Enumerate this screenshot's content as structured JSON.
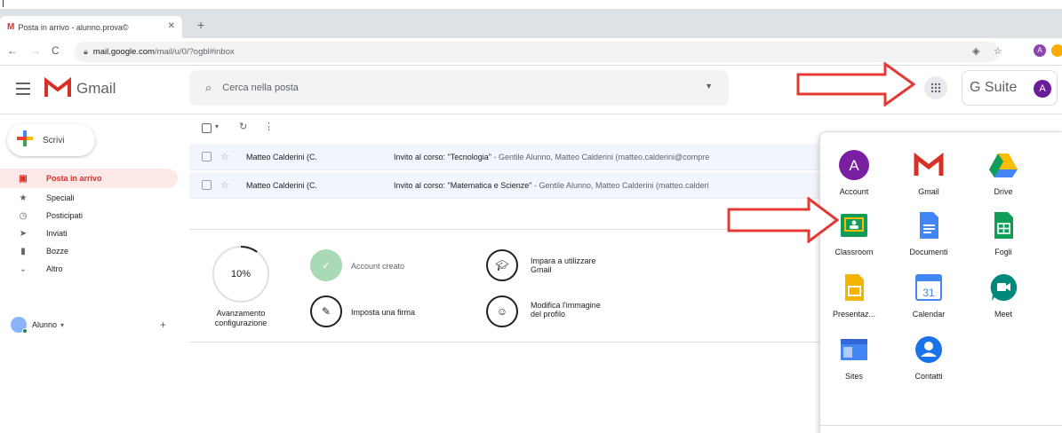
{
  "browser": {
    "tab_title": "Posta in arrivo - alunno.prova©",
    "url_host": "mail.google.com",
    "url_path": "/mail/u/0/?ogbl#inbox",
    "profile_initial": "A"
  },
  "header": {
    "app_name": "Gmail",
    "search_placeholder": "Cerca nella posta",
    "gsuite_label": "G Suite",
    "avatar_initial": "A"
  },
  "sidebar": {
    "compose_label": "Scrivi",
    "items": [
      {
        "label": "Posta in arrivo",
        "icon": "inbox-icon",
        "active": true
      },
      {
        "label": "Speciali",
        "icon": "star-icon"
      },
      {
        "label": "Posticipati",
        "icon": "clock-icon"
      },
      {
        "label": "Inviati",
        "icon": "send-icon"
      },
      {
        "label": "Bozze",
        "icon": "draft-icon"
      },
      {
        "label": "Altro",
        "icon": "chevron-down-icon"
      }
    ],
    "user_label": "Alunno"
  },
  "emails": [
    {
      "sender": "Matteo Calderini (C.",
      "subject": "Invito al corso: \"Tecnologia\"",
      "snippet": " - Gentile Alunno, Matteo Calderini (matteo.calderini@compre"
    },
    {
      "sender": "Matteo Calderini (C.",
      "subject": "Invito al corso: \"Matematica e Scienze\"",
      "snippet": " - Gentile Alunno, Matteo Calderini (matteo.calderi"
    }
  ],
  "setup": {
    "progress_text": "10%",
    "progress_value": 0.1,
    "progress_label_1": "Avanzamento",
    "progress_label_2": "configurazione",
    "steps": [
      {
        "label": "Account creato",
        "done": true
      },
      {
        "label": "Impara a utilizzare Gmail",
        "line1": "Impara a utilizzare",
        "line2": "Gmail"
      },
      {
        "label": "Imposta una firma"
      },
      {
        "label": "Modifica l'immagine del profilo",
        "line1": "Modifica l'immagine",
        "line2": "del profilo"
      }
    ]
  },
  "apps": [
    {
      "label": "Account"
    },
    {
      "label": "Gmail"
    },
    {
      "label": "Drive"
    },
    {
      "label": "Classroom"
    },
    {
      "label": "Documenti"
    },
    {
      "label": "Fogli"
    },
    {
      "label": "Presentaz..."
    },
    {
      "label": "Calendar",
      "badge": "31"
    },
    {
      "label": "Meet"
    },
    {
      "label": "Sites"
    },
    {
      "label": "Contatti"
    }
  ],
  "colors": {
    "annotation_arrow": "#e53935",
    "gmail_red": "#d93025",
    "active_bg": "#fce8e6"
  }
}
